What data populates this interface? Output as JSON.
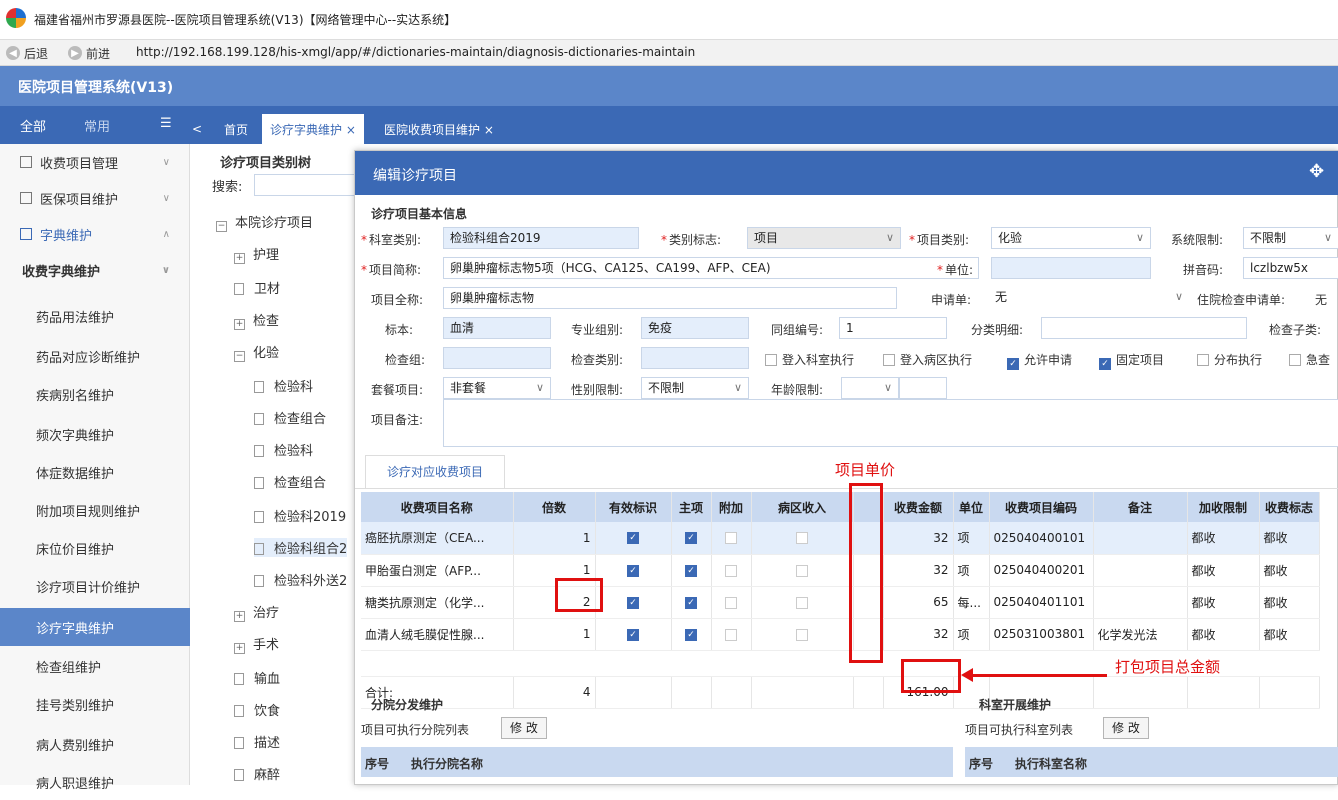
{
  "browser": {
    "title": "福建省福州市罗源县医院--医院项目管理系统(V13)【网络管理中心--实达系统】",
    "back": "后退",
    "forward": "前进",
    "url": "http://192.168.199.128/his-xmgl/app/#/dictionaries-maintain/diagnosis-dictionaries-maintain"
  },
  "app": {
    "title": "医院项目管理系统(V13)"
  },
  "sidetabs": {
    "all": "全部",
    "common": "常用",
    "menu": "☰"
  },
  "tabs": {
    "home": "首页",
    "t1": "诊疗字典维护 ×",
    "t2": "医院收费项目维护 ×"
  },
  "sidebar": {
    "items": [
      "收费项目管理",
      "医保项目维护",
      "字典维护",
      "收费字典维护",
      "药品用法维护",
      "药品对应诊断维护",
      "疾病别名维护",
      "频次字典维护",
      "体症数据维护",
      "附加项目规则维护",
      "床位价目维护",
      "诊疗项目计价维护",
      "诊疗字典维护",
      "检查组维护",
      "挂号类别维护",
      "病人费别维护",
      "病人职退维护"
    ]
  },
  "tree": {
    "title": "诊疗项目类别树",
    "search": "搜索:",
    "nodes": [
      "本院诊疗项目",
      "护理",
      "卫材",
      "检查",
      "化验",
      "检验科",
      "检查组合",
      "检验科",
      "检查组合",
      "检验科2019",
      "检验科组合2",
      "检验科外送2",
      "治疗",
      "手术",
      "输血",
      "饮食",
      "描述",
      "麻醉"
    ]
  },
  "dialog": {
    "title": "编辑诊疗项目",
    "section": "诊疗项目基本信息",
    "labels": {
      "ksb": "科室类别:",
      "lbbz": "类别标志:",
      "xmlb": "项目类别:",
      "xtxz": "系统限制:",
      "xmjc": "项目简称:",
      "dw": "单位:",
      "pym": "拼音码:",
      "xmqc": "项目全称:",
      "sqd": "申请单:",
      "zysqd": "住院检查申请单:",
      "bb": "标本:",
      "zyzb": "专业组别:",
      "tzbh": "同组编号:",
      "flmx": "分类明细:",
      "jczl": "检查子类:",
      "jcz": "检查组:",
      "jclb": "检查类别:",
      "tcxm": "套餐项目:",
      "xbxz": "性别限制:",
      "nlxz": "年龄限制:",
      "xmbz": "项目备注:"
    },
    "values": {
      "ksb": "检验科组合2019",
      "lbbz": "项目",
      "xmlb": "化验",
      "xtxz": "不限制",
      "xmjc": "卵巢肿瘤标志物5项（HCG、CA125、CA199、AFP、CEA)",
      "pym": "lczlbzw5x",
      "xmqc": "卵巢肿瘤标志物",
      "sqd": "无",
      "zysqd": "无",
      "bb": "血清",
      "zyzb": "免疫",
      "tzbh": "1",
      "tcxm": "非套餐",
      "xbxz": "不限制"
    },
    "checks": {
      "c1": "登入科室执行",
      "c2": "登入病区执行",
      "c3": "允许申请",
      "c4": "固定项目",
      "c5": "分布执行",
      "c6": "急查"
    },
    "subtab": "诊疗对应收费项目",
    "grid": {
      "headers": [
        "收费项目名称",
        "倍数",
        "有效标识",
        "主项",
        "附加",
        "病区收入",
        "",
        "收费金额",
        "单位",
        "收费项目编码",
        "备注",
        "加收限制",
        "收费标志"
      ],
      "rows": [
        {
          "name": "癌胚抗原测定（CEA...",
          "bs": "1",
          "je": "32",
          "dw": "项",
          "code": "025040400101",
          "bz": "",
          "jsxz": "都收",
          "sfbz": "都收"
        },
        {
          "name": "甲胎蛋白测定（AFP...",
          "bs": "1",
          "je": "32",
          "dw": "项",
          "code": "025040400201",
          "bz": "",
          "jsxz": "都收",
          "sfbz": "都收"
        },
        {
          "name": "糖类抗原测定（化学...",
          "bs": "2",
          "je": "65",
          "dw": "每...",
          "code": "025040401101",
          "bz": "",
          "jsxz": "都收",
          "sfbz": "都收"
        },
        {
          "name": "血清人绒毛膜促性腺...",
          "bs": "1",
          "je": "32",
          "dw": "项",
          "code": "025031003801",
          "bz": "化学发光法",
          "jsxz": "都收",
          "sfbz": "都收"
        }
      ],
      "total_label": "合计:",
      "total_bs": "4",
      "total_je": "161.00"
    },
    "annot": {
      "price": "项目单价",
      "total": "打包项目总金额"
    },
    "branch": {
      "title": "分院分发维护",
      "list": "项目可执行分院列表",
      "btn": "修 改",
      "col1": "序号",
      "col2": "执行分院名称"
    },
    "dept": {
      "title": "科室开展维护",
      "list": "项目可执行科室列表",
      "btn": "修 改",
      "col1": "序号",
      "col2": "执行科室名称"
    }
  }
}
